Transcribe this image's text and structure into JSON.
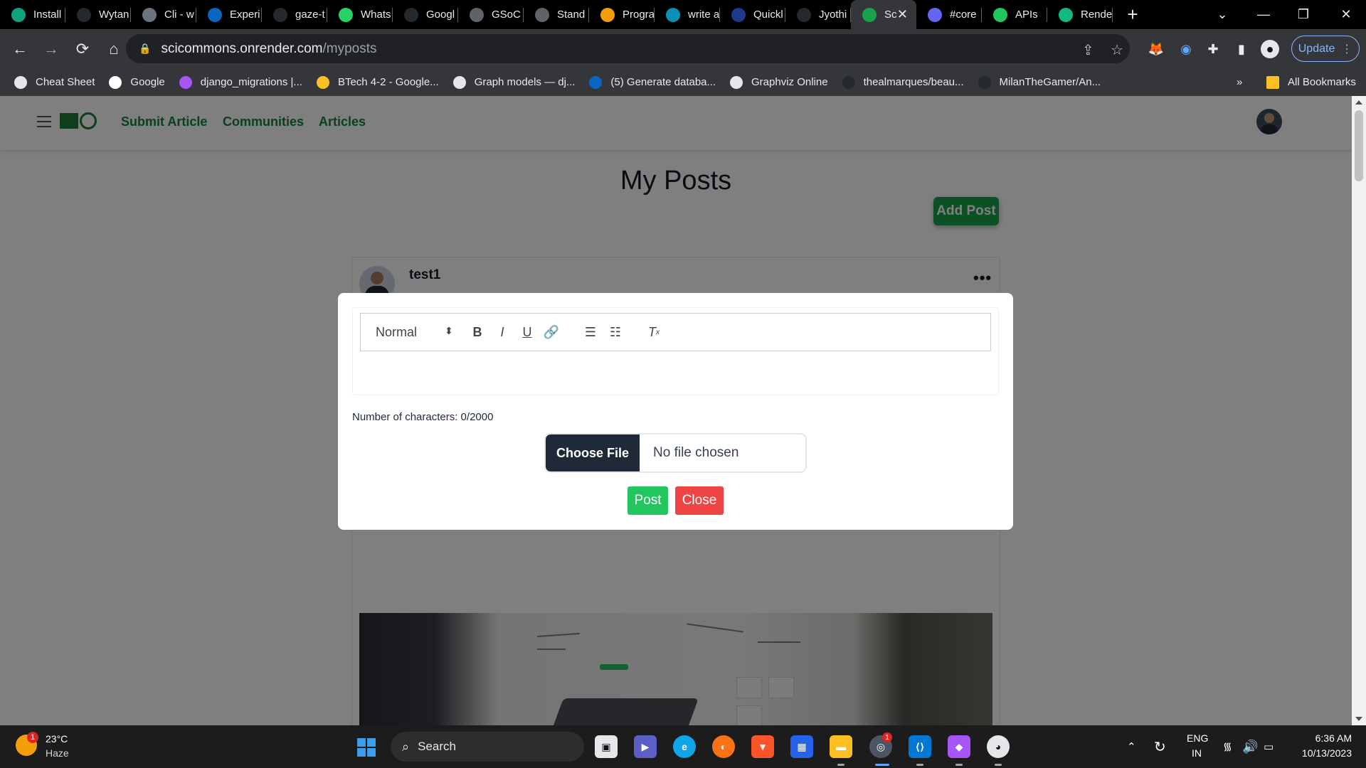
{
  "browser": {
    "tabs": [
      {
        "label": "Install",
        "icon": "chatgpt-icon",
        "color": "#10a37f"
      },
      {
        "label": "Wytan",
        "icon": "github-icon",
        "color": "#24292e"
      },
      {
        "label": "Cli - w",
        "icon": "app-icon",
        "color": "#6b7280"
      },
      {
        "label": "Experi",
        "icon": "linkedin-icon",
        "color": "#0a66c2"
      },
      {
        "label": "gaze-t",
        "icon": "github-icon",
        "color": "#24292e"
      },
      {
        "label": "Whats",
        "icon": "whatsapp-icon",
        "color": "#25d366"
      },
      {
        "label": "Googl",
        "icon": "github-icon",
        "color": "#24292e"
      },
      {
        "label": "GSoC",
        "icon": "globe-icon",
        "color": "#5f6368"
      },
      {
        "label": "Stand",
        "icon": "globe-icon",
        "color": "#5f6368"
      },
      {
        "label": "Progra",
        "icon": "gear-icon",
        "color": "#f59e0b"
      },
      {
        "label": "write a",
        "icon": "tree-icon",
        "color": "#0891b2"
      },
      {
        "label": "Quickl",
        "icon": "quick-icon",
        "color": "#1e3a8a"
      },
      {
        "label": "Jyothi",
        "icon": "github-icon",
        "color": "#24292e"
      },
      {
        "label": "Sc",
        "icon": "scicommons-icon",
        "color": "#16a34a",
        "active": true
      },
      {
        "label": "#core",
        "icon": "zulip-icon",
        "color": "#6366f1"
      },
      {
        "label": "APIs",
        "icon": "api-icon",
        "color": "#22c55e"
      },
      {
        "label": "Rende",
        "icon": "render-icon",
        "color": "#10b981"
      }
    ],
    "address": {
      "domain": "scicommons.onrender.com",
      "path": "/myposts"
    },
    "update_label": "Update",
    "bookmarks": [
      {
        "label": "Cheat Sheet",
        "color": "#e5e7eb"
      },
      {
        "label": "Google",
        "color": "#ffffff"
      },
      {
        "label": "django_migrations |...",
        "color": "#a855f7"
      },
      {
        "label": "BTech 4-2 - Google...",
        "color": "#fbbf24"
      },
      {
        "label": "Graph models — dj...",
        "color": "#e5e7eb"
      },
      {
        "label": "(5) Generate databa...",
        "color": "#0a66c2"
      },
      {
        "label": "Graphviz Online",
        "color": "#e5e7eb"
      },
      {
        "label": "thealmarques/beau...",
        "color": "#24292e"
      },
      {
        "label": "MilanTheGamer/An...",
        "color": "#24292e"
      }
    ],
    "more_bookmarks": "»",
    "all_bookmarks": "All Bookmarks"
  },
  "site": {
    "nav": {
      "submit": "Submit Article",
      "communities": "Communities",
      "articles": "Articles"
    },
    "page_title": "My Posts",
    "add_post": "Add Post",
    "post": {
      "username": "test1",
      "menu": "•••"
    }
  },
  "modal": {
    "editor": {
      "format_select": "Normal"
    },
    "char_count": "Number of characters: 0/2000",
    "file": {
      "button": "Choose File",
      "status": "No file chosen"
    },
    "post_button": "Post",
    "close_button": "Close"
  },
  "taskbar": {
    "weather": {
      "temp": "23°C",
      "desc": "Haze",
      "badge": "1"
    },
    "search_placeholder": "Search",
    "lang": {
      "line1": "ENG",
      "line2": "IN"
    },
    "clock": {
      "time": "6:36 AM",
      "date": "10/13/2023"
    },
    "chrome_badge": "1"
  }
}
